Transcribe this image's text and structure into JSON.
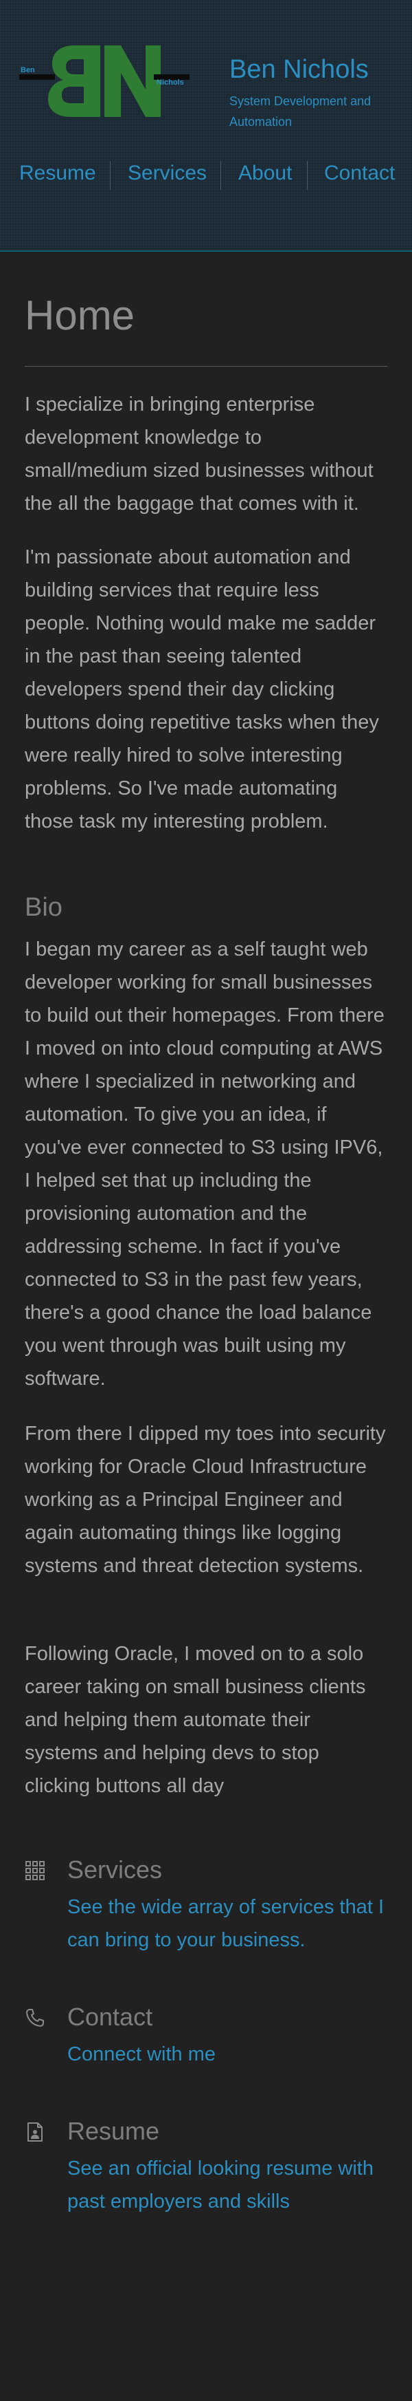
{
  "header": {
    "logo": {
      "monogram_left": "B",
      "monogram_right": "N",
      "small_left": "Ben",
      "small_right": "Nichols"
    },
    "site_title": "Ben Nichols",
    "tagline": "System Development and Automation",
    "nav": [
      {
        "label": "Resume"
      },
      {
        "label": "Services"
      },
      {
        "label": "About"
      },
      {
        "label": "Contact"
      }
    ]
  },
  "main": {
    "title": "Home",
    "intro": [
      "I specialize in bringing enterprise development knowledge to small/medium sized businesses without the all the baggage that comes with it.",
      "I'm passionate about automation and building services that require less people. Nothing would make me sadder in the past than seeing talented developers spend their day clicking buttons doing repetitive tasks when they were really hired to solve interesting problems. So I've made automating those task my interesting problem."
    ],
    "bio_heading": "Bio",
    "bio": [
      "I began my career as a self taught web developer working for small businesses to build out their homepages. From there I moved on into cloud computing at AWS where I specialized in networking and automation. To give you an idea, if you've ever connected to S3 using IPV6, I helped set that up including the provisioning automation and the addressing scheme. In fact if you've connected to S3 in the past few years, there's a good chance the load balance you went through was built using my software.",
      "From there I dipped my toes into security working for Oracle Cloud Infrastructure working as a Principal Engineer and again automating things like logging systems and threat detection systems.",
      "Following Oracle, I moved on to a solo career taking on small business clients and helping them automate their systems and helping devs to stop clicking buttons all day"
    ],
    "cards": [
      {
        "title": "Services",
        "link": "See the wide array of services that I can bring to your business.",
        "icon": "services-grid-icon"
      },
      {
        "title": "Contact",
        "link": "Connect with me",
        "icon": "phone-icon"
      },
      {
        "title": "Resume",
        "link": "See an official looking resume with past employers and skills",
        "icon": "resume-document-icon"
      }
    ]
  },
  "colors": {
    "background": "#212121",
    "header_background": "#1c2a36",
    "accent_blue": "#2b8fc2",
    "logo_green": "#2e7d32",
    "body_text": "#a9a9a9",
    "heading_text": "#7d7d7d"
  }
}
